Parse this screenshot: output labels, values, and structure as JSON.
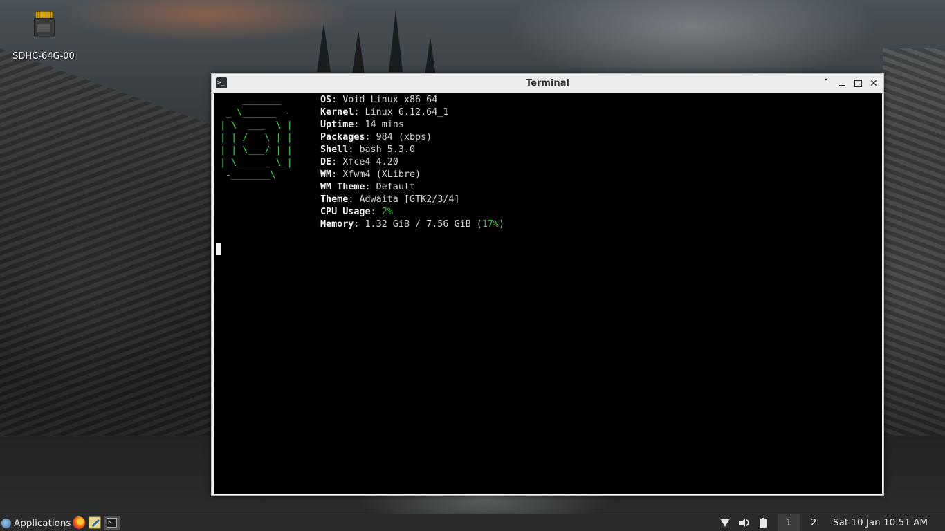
{
  "desktop": {
    "icons": [
      {
        "label": "SDHC-64G-00",
        "icon": "sd-card-icon"
      }
    ]
  },
  "window": {
    "title": "Terminal",
    "app_icon": "terminal-icon",
    "buttons": [
      "shade-icon",
      "minimize-icon",
      "maximize-icon",
      "close-icon"
    ]
  },
  "terminal": {
    "logo_color": "#3ddc3d",
    "ascii_logo": [
      "    _______",
      " _ \\______ -",
      "| \\  ___  \\ |",
      "| | /   \\ | |",
      "| | \\___/ | |",
      "| \\______ \\_|",
      " -_______\\"
    ],
    "info": [
      {
        "key": "OS",
        "sep": ": ",
        "value": "Void Linux x86_64"
      },
      {
        "key": "Kernel",
        "sep": ": ",
        "value": "Linux 6.12.64_1"
      },
      {
        "key": "Uptime",
        "sep": ": ",
        "value": "14 mins"
      },
      {
        "key": "Packages",
        "sep": ": ",
        "value": "984 (xbps)"
      },
      {
        "key": "Shell",
        "sep": ": ",
        "value": "bash 5.3.0"
      },
      {
        "key": "DE",
        "sep": ": ",
        "value": "Xfce4 4.20"
      },
      {
        "key": "WM",
        "sep": ": ",
        "value": "Xfwm4 (XLibre)"
      },
      {
        "key": "WM Theme",
        "sep": ": ",
        "value": "Default"
      },
      {
        "key": "Theme",
        "sep": ": ",
        "value": "Adwaita [GTK2/3/4]"
      },
      {
        "key": "CPU Usage",
        "sep": ": ",
        "value": "2%"
      },
      {
        "key": "Memory",
        "sep": ": ",
        "value_prefix": "1.32 GiB / 7.56 GiB (",
        "value_pct": "17%",
        "value_suffix": ")"
      }
    ]
  },
  "taskbar": {
    "applications_label": "Applications",
    "launchers": [
      "firefox-icon",
      "text-editor-icon",
      "terminal-icon"
    ],
    "tray": [
      "wifi-icon",
      "volume-icon",
      "battery-icon"
    ],
    "workspaces": [
      "1",
      "2"
    ],
    "active_workspace": "1",
    "clock": "Sat 10 Jan 10:51 AM"
  }
}
